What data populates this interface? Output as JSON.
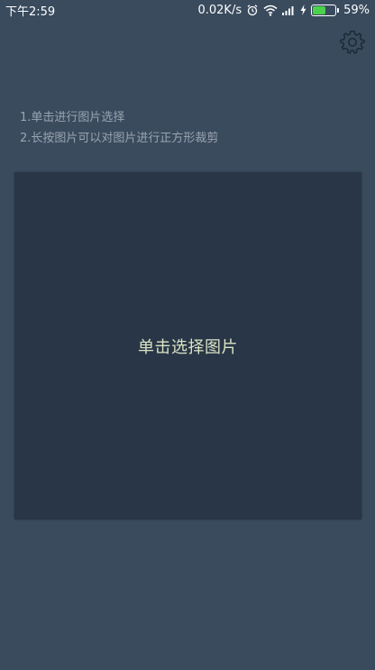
{
  "status_bar": {
    "time": "下午2:59",
    "network_speed": "0.02K/s",
    "battery_percent": "59%",
    "battery_level": 0.59,
    "icons": [
      "alarm-icon",
      "wifi-icon",
      "signal-icon",
      "charging-icon",
      "battery-icon"
    ]
  },
  "header": {
    "settings_icon": "gear-icon"
  },
  "instructions": {
    "line1": "1.单击进行图片选择",
    "line2": "2.长按图片可以对图片进行正方形裁剪"
  },
  "picker": {
    "label": "单击选择图片"
  },
  "colors": {
    "background": "#3a4b5e",
    "panel": "#283647",
    "instruction_text": "#9aa4b0",
    "picker_text": "#dbe3c4",
    "battery_fill": "#4cd14c"
  }
}
